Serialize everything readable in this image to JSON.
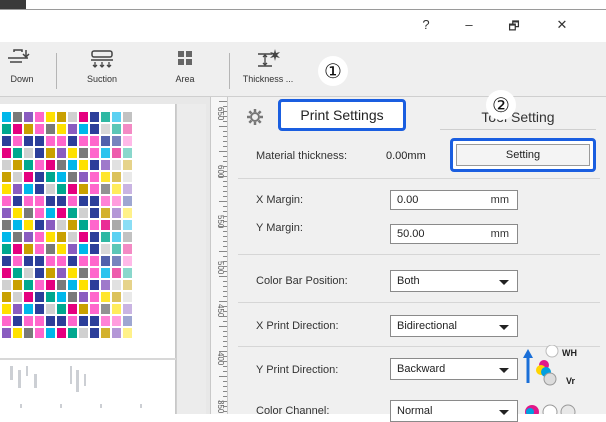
{
  "window": {
    "help": "?",
    "minimize": "–",
    "restore": "🗗",
    "close": "✕"
  },
  "toolbar": {
    "items": [
      {
        "label": "Down"
      },
      {
        "label": "Suction"
      },
      {
        "label": "Area"
      },
      {
        "label": "Thickness ..."
      }
    ]
  },
  "callouts": {
    "one": "①",
    "two": "②"
  },
  "ruler": {
    "labels": [
      "650",
      "600",
      "550",
      "500",
      "450",
      "400",
      "350"
    ]
  },
  "tabs": {
    "print_settings": "Print Settings",
    "tool_setting": "Tool Setting"
  },
  "settings": {
    "material_thickness_label": "Material thickness:",
    "material_thickness_value": "0.00mm",
    "setting_button": "Setting",
    "x_margin_label": "X Margin:",
    "x_margin_value": "0.00",
    "x_margin_unit": "mm",
    "y_margin_label": "Y Margin:",
    "y_margin_value": "50.00",
    "y_margin_unit": "mm",
    "color_bar_label": "Color Bar Position:",
    "color_bar_value": "Both",
    "x_dir_label": "X Print Direction:",
    "x_dir_value": "Bidirectional",
    "y_dir_label": "Y Print Direction:",
    "y_dir_value": "Backward",
    "ink_wh": "WH",
    "ink_vr": "Vr",
    "color_channel_label": "Color Channel:",
    "color_channel_value": "Normal"
  },
  "colors": {
    "highlight": "#1a5ee0",
    "arrow": "#1a6fd8"
  }
}
